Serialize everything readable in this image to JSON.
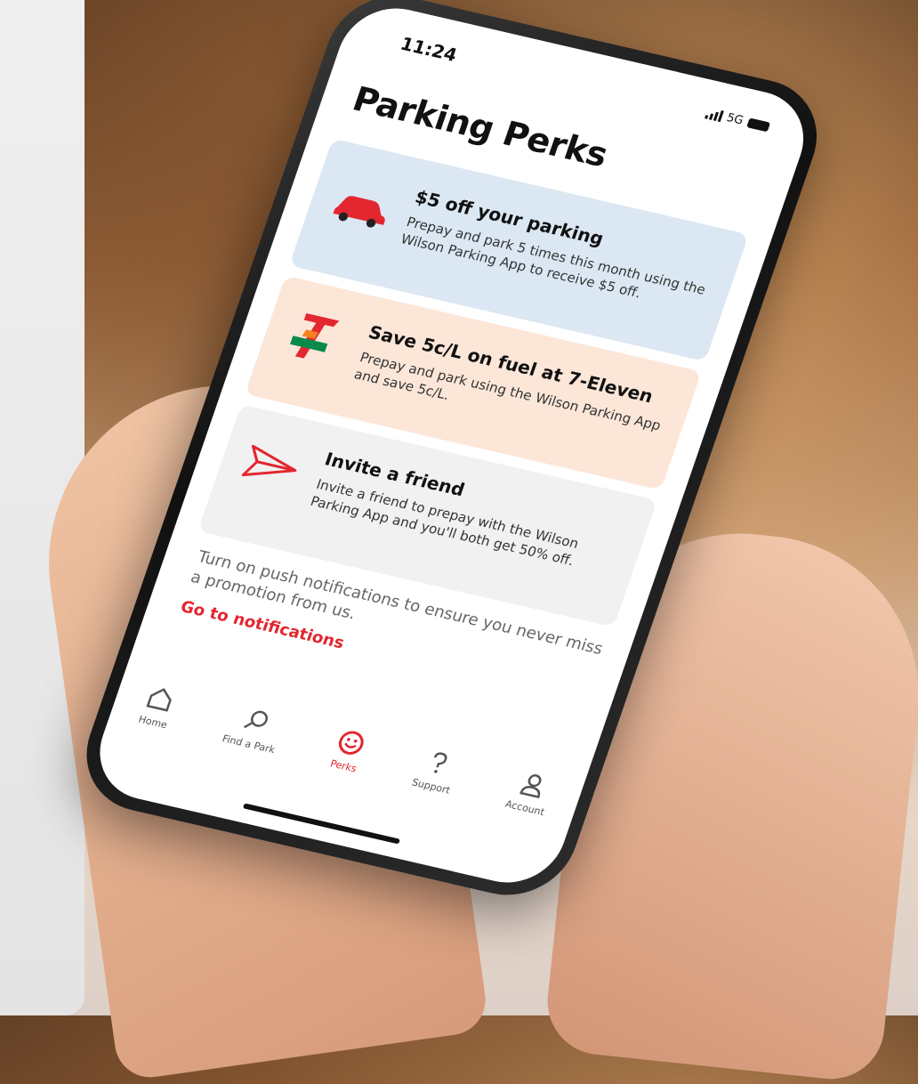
{
  "status_bar": {
    "time": "11:24",
    "network": "5G"
  },
  "page": {
    "title": "Parking Perks"
  },
  "perks": [
    {
      "icon": "car-icon",
      "title": "$5 off your parking",
      "description": "Prepay and park 5 times this month using the Wilson Parking App to receive $5 off."
    },
    {
      "icon": "7-eleven-logo",
      "title": "Save 5c/L on fuel at 7-Eleven",
      "description": "Prepay and park using the Wilson Parking App and save 5c/L."
    },
    {
      "icon": "paper-plane-icon",
      "title": "Invite a friend",
      "description": "Invite a friend to prepay with the Wilson Parking App and you'll both get 50% off."
    }
  ],
  "notification_note": "Turn on push notifications to ensure you never miss a promotion from us.",
  "notification_link": "Go to notifications",
  "tabs": [
    {
      "label": "Home",
      "icon": "home-icon",
      "active": false
    },
    {
      "label": "Find a Park",
      "icon": "search-icon",
      "active": false
    },
    {
      "label": "Perks",
      "icon": "smiley-icon",
      "active": true
    },
    {
      "label": "Support",
      "icon": "question-icon",
      "active": false
    },
    {
      "label": "Account",
      "icon": "account-icon",
      "active": false
    }
  ],
  "colors": {
    "accent": "#e3262f",
    "card_blue": "#dbe8f3",
    "card_peach": "#fbe6d8",
    "card_grey": "#f1f1f1"
  }
}
